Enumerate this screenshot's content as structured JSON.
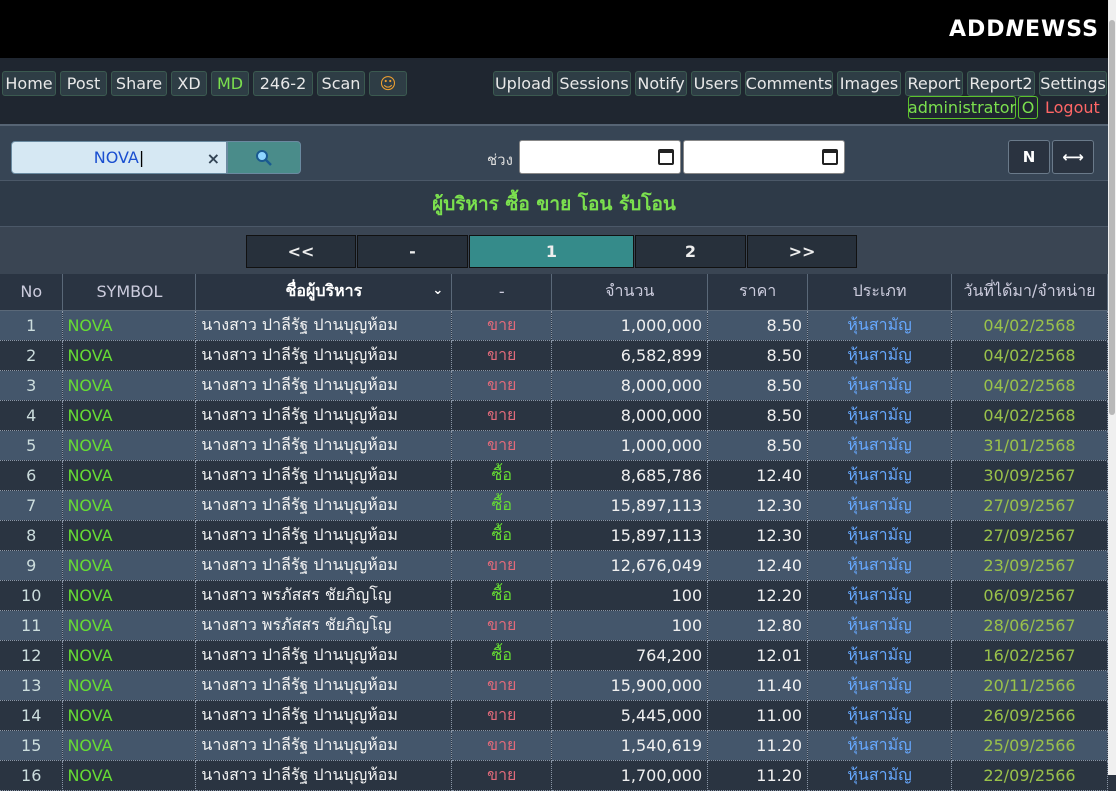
{
  "logo": {
    "text_left": "ADD",
    "text_mid": "N",
    "text_right": "EWSS"
  },
  "nav_left": [
    "Home",
    "Post",
    "Share",
    "XD",
    "MD",
    "246-2",
    "Scan"
  ],
  "nav_right": [
    "Upload",
    "Sessions",
    "Notify",
    "Users",
    "Comments",
    "Images",
    "Report",
    "Report2",
    "Settings"
  ],
  "user": {
    "name": "administrator",
    "badge": "O",
    "logout": "Logout"
  },
  "search": {
    "value": "NOVA",
    "clear": "×",
    "button_icon": "search-icon"
  },
  "range": {
    "label": "ช่วง"
  },
  "buttons": {
    "n": "N",
    "swap": "⟷"
  },
  "title": "ผู้บริหาร ซื้อ ขาย โอน รับโอน",
  "pager": {
    "first": "<<",
    "prev": "-",
    "current": "1",
    "next_page": "2",
    "last": ">>"
  },
  "table": {
    "headers": [
      "No",
      "SYMBOL",
      "ชื่อผู้บริหาร",
      "-",
      "จำนวน",
      "ราคา",
      "ประเภท",
      "วันที่ได้มา/จำหน่าย"
    ],
    "rows": [
      {
        "no": "1",
        "symbol": "NOVA",
        "name": "นางสาว ปาลีรัฐ ปานบุญห้อม",
        "type": "ขาย",
        "qty": "1,000,000",
        "price": "8.50",
        "kind": "หุ้นสามัญ",
        "date": "04/02/2568"
      },
      {
        "no": "2",
        "symbol": "NOVA",
        "name": "นางสาว ปาลีรัฐ ปานบุญห้อม",
        "type": "ขาย",
        "qty": "6,582,899",
        "price": "8.50",
        "kind": "หุ้นสามัญ",
        "date": "04/02/2568"
      },
      {
        "no": "3",
        "symbol": "NOVA",
        "name": "นางสาว ปาลีรัฐ ปานบุญห้อม",
        "type": "ขาย",
        "qty": "8,000,000",
        "price": "8.50",
        "kind": "หุ้นสามัญ",
        "date": "04/02/2568"
      },
      {
        "no": "4",
        "symbol": "NOVA",
        "name": "นางสาว ปาลีรัฐ ปานบุญห้อม",
        "type": "ขาย",
        "qty": "8,000,000",
        "price": "8.50",
        "kind": "หุ้นสามัญ",
        "date": "04/02/2568"
      },
      {
        "no": "5",
        "symbol": "NOVA",
        "name": "นางสาว ปาลีรัฐ ปานบุญห้อม",
        "type": "ขาย",
        "qty": "1,000,000",
        "price": "8.50",
        "kind": "หุ้นสามัญ",
        "date": "31/01/2568"
      },
      {
        "no": "6",
        "symbol": "NOVA",
        "name": "นางสาว ปาลีรัฐ ปานบุญห้อม",
        "type": "ซื้อ",
        "qty": "8,685,786",
        "price": "12.40",
        "kind": "หุ้นสามัญ",
        "date": "30/09/2567"
      },
      {
        "no": "7",
        "symbol": "NOVA",
        "name": "นางสาว ปาลีรัฐ ปานบุญห้อม",
        "type": "ซื้อ",
        "qty": "15,897,113",
        "price": "12.30",
        "kind": "หุ้นสามัญ",
        "date": "27/09/2567"
      },
      {
        "no": "8",
        "symbol": "NOVA",
        "name": "นางสาว ปาลีรัฐ ปานบุญห้อม",
        "type": "ซื้อ",
        "qty": "15,897,113",
        "price": "12.30",
        "kind": "หุ้นสามัญ",
        "date": "27/09/2567"
      },
      {
        "no": "9",
        "symbol": "NOVA",
        "name": "นางสาว ปาลีรัฐ ปานบุญห้อม",
        "type": "ขาย",
        "qty": "12,676,049",
        "price": "12.40",
        "kind": "หุ้นสามัญ",
        "date": "23/09/2567"
      },
      {
        "no": "10",
        "symbol": "NOVA",
        "name": "นางสาว พรภัสสร ชัยภิญโญ",
        "type": "ซื้อ",
        "qty": "100",
        "price": "12.20",
        "kind": "หุ้นสามัญ",
        "date": "06/09/2567"
      },
      {
        "no": "11",
        "symbol": "NOVA",
        "name": "นางสาว พรภัสสร ชัยภิญโญ",
        "type": "ขาย",
        "qty": "100",
        "price": "12.80",
        "kind": "หุ้นสามัญ",
        "date": "28/06/2567"
      },
      {
        "no": "12",
        "symbol": "NOVA",
        "name": "นางสาว ปาลีรัฐ ปานบุญห้อม",
        "type": "ซื้อ",
        "qty": "764,200",
        "price": "12.01",
        "kind": "หุ้นสามัญ",
        "date": "16/02/2567"
      },
      {
        "no": "13",
        "symbol": "NOVA",
        "name": "นางสาว ปาลีรัฐ ปานบุญห้อม",
        "type": "ขาย",
        "qty": "15,900,000",
        "price": "11.40",
        "kind": "หุ้นสามัญ",
        "date": "20/11/2566"
      },
      {
        "no": "14",
        "symbol": "NOVA",
        "name": "นางสาว ปาลีรัฐ ปานบุญห้อม",
        "type": "ขาย",
        "qty": "5,445,000",
        "price": "11.00",
        "kind": "หุ้นสามัญ",
        "date": "26/09/2566"
      },
      {
        "no": "15",
        "symbol": "NOVA",
        "name": "นางสาว ปาลีรัฐ ปานบุญห้อม",
        "type": "ขาย",
        "qty": "1,540,619",
        "price": "11.20",
        "kind": "หุ้นสามัญ",
        "date": "25/09/2566"
      },
      {
        "no": "16",
        "symbol": "NOVA",
        "name": "นางสาว ปาลีรัฐ ปานบุญห้อม",
        "type": "ขาย",
        "qty": "1,700,000",
        "price": "11.20",
        "kind": "หุ้นสามัญ",
        "date": "22/09/2566"
      }
    ]
  }
}
